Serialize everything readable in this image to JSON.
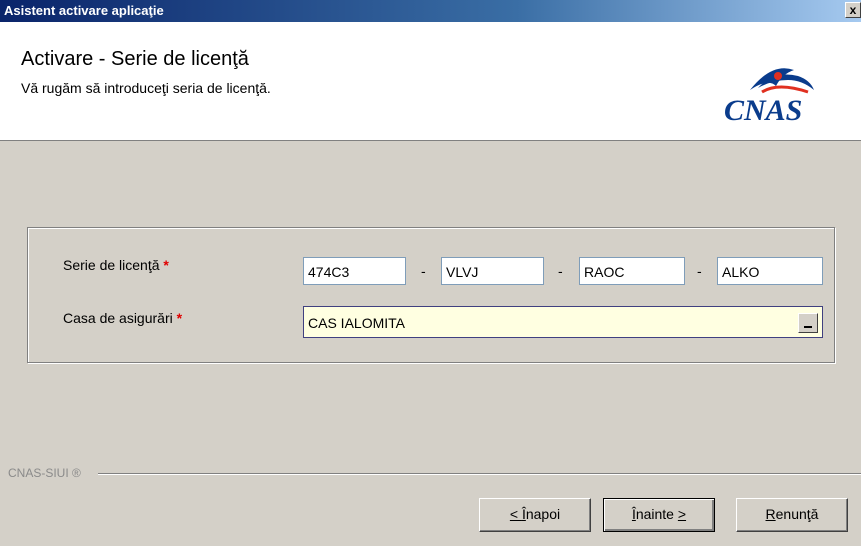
{
  "window": {
    "title": "Asistent activare aplicaţie",
    "close_label": "x"
  },
  "header": {
    "title": "Activare - Serie de licenţă",
    "subtitle": "Vă rugăm să introduceţi seria de licenţă.",
    "logo_text": "CNAS",
    "logo_colors": {
      "text": "#0a3c8c",
      "accent": "#e03020"
    }
  },
  "form": {
    "license": {
      "label": "Serie de licenţă",
      "required_mark": "*",
      "parts": [
        "474C3",
        "VLVJ",
        "RAOC",
        "ALKO"
      ],
      "separator": "-"
    },
    "insurance": {
      "label": "Casa de asigurări",
      "required_mark": "*",
      "value": "CAS IALOMITA"
    }
  },
  "footer": {
    "brand": "CNAS-SIUI ®",
    "buttons": {
      "back": {
        "prefix": "< ",
        "key": "Î",
        "rest": "napoi"
      },
      "next": {
        "key": "Î",
        "rest": "nainte ",
        "suffix": ">"
      },
      "cancel": {
        "key": "R",
        "rest": "enunţă"
      }
    }
  }
}
